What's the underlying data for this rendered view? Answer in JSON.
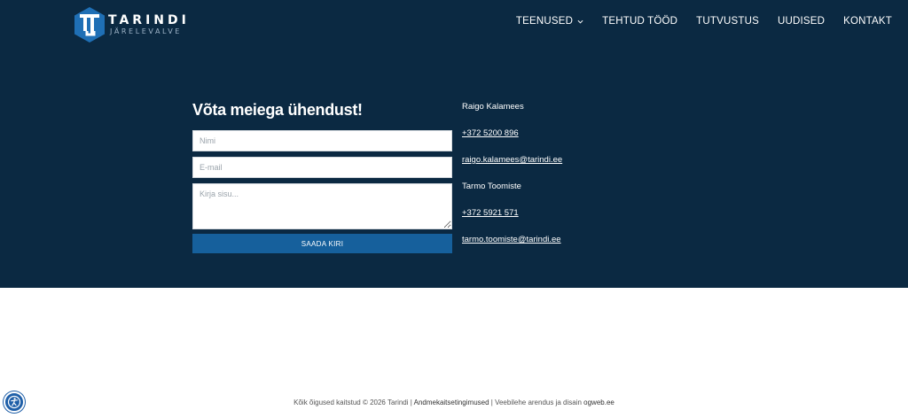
{
  "brand": {
    "name": "TARINDI",
    "tagline": "JÄRELEVALVE",
    "colors": {
      "primary": "#0b2942",
      "accent": "#16609c",
      "logo": "#1f6fb5"
    }
  },
  "nav": {
    "items": [
      {
        "label": "TEENUSED",
        "has_dropdown": true
      },
      {
        "label": "TEHTUD TÖÖD"
      },
      {
        "label": "TUTVUSTUS"
      },
      {
        "label": "UUDISED"
      },
      {
        "label": "KONTAKT"
      }
    ]
  },
  "contact_form": {
    "title": "Võta meiega ühendust!",
    "name_placeholder": "Nimi",
    "email_placeholder": "E-mail",
    "message_placeholder": "Kirja sisu...",
    "submit_label": "SAADA KIRI"
  },
  "contacts": [
    {
      "name": "Raigo Kalamees",
      "phone": "+372 5200 896",
      "email": "raigo.kalamees@tarindi.ee"
    },
    {
      "name": "Tarmo Toomiste",
      "phone": "+372 5921 571",
      "email": "tarmo.toomiste@tarindi.ee"
    }
  ],
  "footer": {
    "copyright": "Kõik õigused kaitstud © 2026 Tarindi | ",
    "privacy_link": "Andmekaitsetingimused",
    "sep": " | Veebilehe arendus ja disain ",
    "dev_link": "ogweb.ee"
  },
  "accessibility": {
    "icon": "accessibility-icon"
  }
}
